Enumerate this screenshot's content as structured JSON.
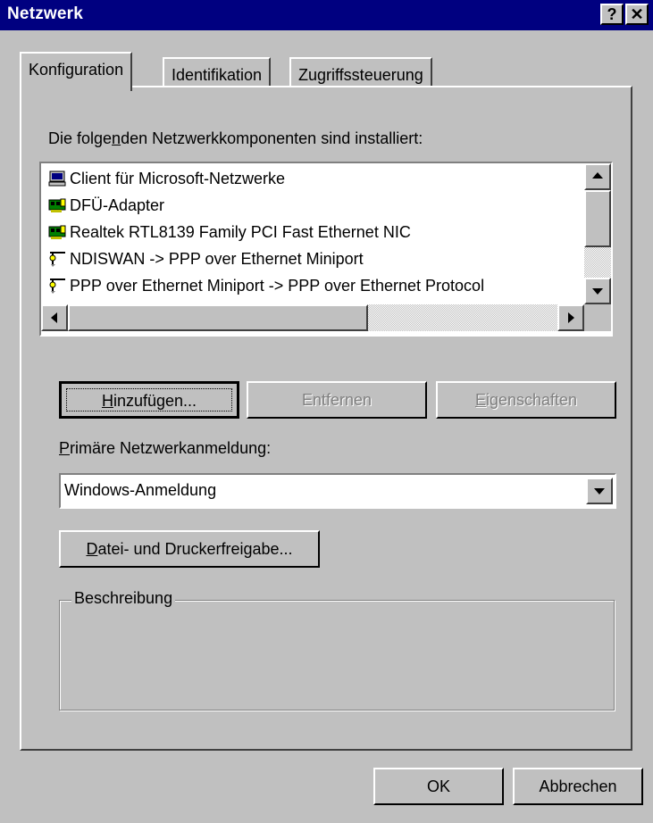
{
  "window": {
    "title": "Netzwerk",
    "help_glyph": "?",
    "close_glyph": "✕"
  },
  "tabs": [
    {
      "label": "Konfiguration",
      "active": true
    },
    {
      "label": "Identifikation",
      "active": false
    },
    {
      "label": "Zugriffssteuerung",
      "active": false
    }
  ],
  "components": {
    "label_pre": "Die folge",
    "label_accel": "n",
    "label_post": "den Netzwerkkomponenten sind installiert:",
    "items": [
      {
        "label": "Client für Microsoft-Netzwerke",
        "icon": "network-client-icon"
      },
      {
        "label": "DFÜ-Adapter",
        "icon": "network-adapter-icon"
      },
      {
        "label": "Realtek RTL8139 Family PCI Fast Ethernet NIC",
        "icon": "network-adapter-icon"
      },
      {
        "label": "NDISWAN -> PPP over Ethernet Miniport",
        "icon": "protocol-icon"
      },
      {
        "label": "PPP over Ethernet Miniport -> PPP over Ethernet Protocol",
        "icon": "protocol-icon"
      }
    ]
  },
  "buttons": {
    "add": {
      "accel": "H",
      "rest": "inzufügen..."
    },
    "remove": {
      "label": "Entfernen"
    },
    "properties": {
      "accel": "E",
      "rest": "igenschaften"
    },
    "file_printer": {
      "accel": "D",
      "rest": "atei- und Druckerfreigabe..."
    },
    "ok": "OK",
    "cancel": "Abbrechen"
  },
  "logon": {
    "label_accel": "P",
    "label_rest": "rimäre Netzwerkanmeldung:",
    "selected": "Windows-Anmeldung"
  },
  "description": {
    "legend": "Beschreibung"
  },
  "colors": {
    "titlebar": "#000080",
    "face": "#c0c0c0",
    "shadow": "#808080",
    "highlight": "#ffffff"
  }
}
